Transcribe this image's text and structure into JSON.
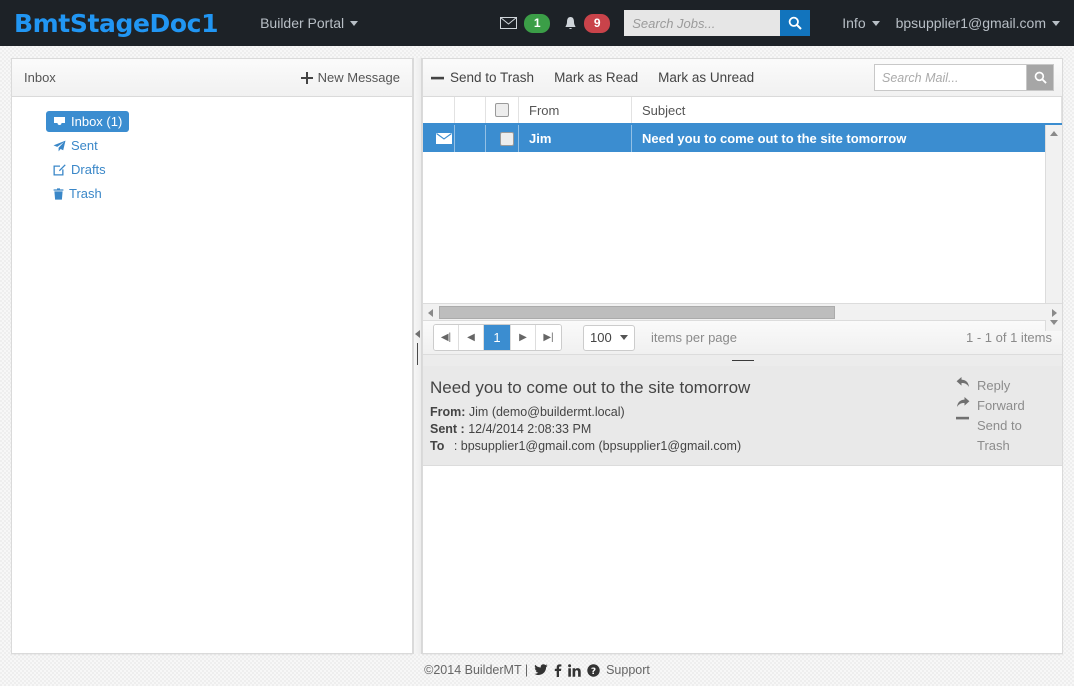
{
  "topnav": {
    "brand": "BmtStageDoc1",
    "portal": "Builder Portal",
    "mail_icon": "envelope-icon",
    "mail_badge": "1",
    "bell_icon": "bell-icon",
    "bell_badge": "9",
    "search_placeholder": "Search Jobs...",
    "search_value": "",
    "search_button_icon": "search-icon",
    "info": "Info",
    "account": "bpsupplier1@gmail.com",
    "accent_blue": "#2196f3",
    "bar_color": "#1d2227",
    "badge_green": "#3b9e47",
    "badge_red": "#c9434a"
  },
  "left_panel": {
    "title": "Inbox",
    "new_message": "New Message",
    "new_message_icon": "plus-icon",
    "folders": [
      {
        "label": "Inbox (1)",
        "icon": "inbox-icon",
        "active": true
      },
      {
        "label": "Sent",
        "icon": "paper-plane-icon",
        "active": false
      },
      {
        "label": "Drafts",
        "icon": "pencil-square-icon",
        "active": false
      },
      {
        "label": "Trash",
        "icon": "trash-icon",
        "active": false
      }
    ]
  },
  "mail_toolbar": {
    "send_to_trash": "Send to Trash",
    "send_to_trash_icon": "minus-icon",
    "mark_as_read": "Mark as Read",
    "mark_as_unread": "Mark as Unread",
    "search_placeholder": "Search Mail...",
    "search_value": "",
    "search_button_icon": "search-icon"
  },
  "grid": {
    "columns": [
      "",
      "",
      "",
      "From",
      "Subject"
    ],
    "rows": [
      {
        "status_icon": "envelope-icon",
        "checked": false,
        "from": "Jim",
        "subject": "Need you to come out to the site tomorrow",
        "selected": true
      }
    ],
    "selected_color": "#3b8dd0"
  },
  "pager": {
    "first_icon": "first-page-icon",
    "prev_icon": "prev-page-icon",
    "current_page": "1",
    "next_icon": "next-page-icon",
    "last_icon": "last-page-icon",
    "page_size": "100",
    "items_per_page_label": "items per page",
    "range_text": "1 - 1 of 1 items"
  },
  "detail": {
    "subject": "Need you to come out to the site tomorrow",
    "from_label": "From:",
    "from_value": "Jim (demo@buildermt.local)",
    "sent_label": "Sent :",
    "sent_value": "12/4/2014 2:08:33 PM",
    "to_label": "To",
    "to_value": ": bpsupplier1@gmail.com (bpsupplier1@gmail.com)",
    "actions": [
      {
        "label": "Reply",
        "icon": "reply-arrow-icon"
      },
      {
        "label": "Forward",
        "icon": "forward-arrow-icon"
      },
      {
        "label": "Send to Trash",
        "icon": "minus-icon"
      }
    ],
    "body": ""
  },
  "footer": {
    "copyright": "©2014 BuilderMT |",
    "twitter_icon": "twitter-icon",
    "facebook_icon": "facebook-icon",
    "linkedin_icon": "linkedin-icon",
    "support_icon": "question-circle-icon",
    "support": "Support"
  }
}
